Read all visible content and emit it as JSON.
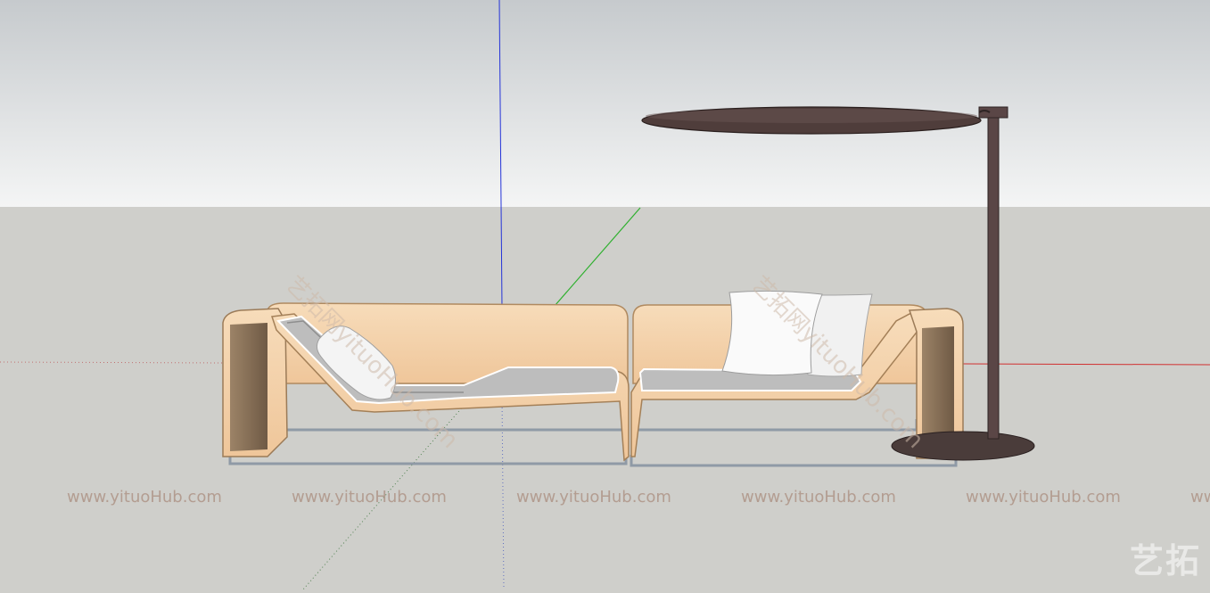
{
  "scene": {
    "sky_color_top": "#c9cdd0",
    "sky_color_bottom": "#f3f4f4",
    "ground_color": "#cfcfcb",
    "axis_blue": "#2030d0",
    "axis_green": "#30b030",
    "axis_red": "#d03030",
    "sofa_wood": "#f2cfa6",
    "cushion_color": "#b9b9b9",
    "umbrella_color": "#4a3a38"
  },
  "watermark": {
    "repeat_text": "www.yituoHub.com",
    "diagonal_left": "艺拓网yituoHub.com",
    "diagonal_right": "艺拓网yituoHub.com",
    "logo": "艺拓"
  }
}
